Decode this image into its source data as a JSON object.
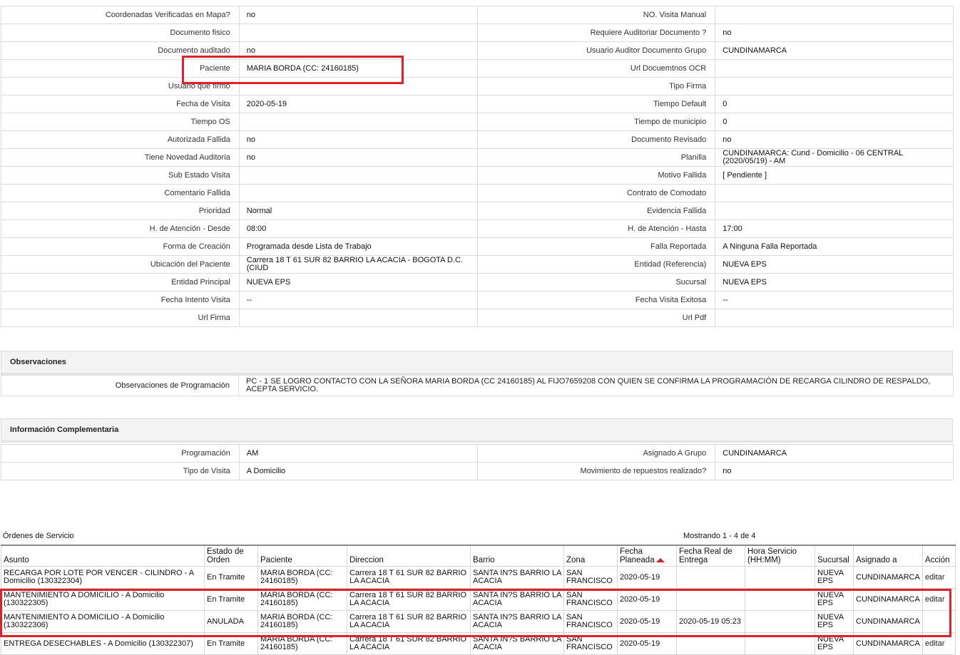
{
  "detail_rows": [
    {
      "l1": "Coordenadas Verificadas en Mapa?",
      "v1": "no",
      "l2": "NO. Visita Manual",
      "v2": ""
    },
    {
      "l1": "Documento fisico",
      "v1": "",
      "l2": "Requiere Auditoriar Documento ?",
      "v2": "no"
    },
    {
      "l1": "Documento auditado",
      "v1": "no",
      "l2": "Usuario Auditor Documento Grupo",
      "v2": "CUNDINAMARCA"
    },
    {
      "l1": "Paciente",
      "v1": "MARIA BORDA (CC: 24160185)",
      "l2": "Url Docuemtnos OCR",
      "v2": ""
    },
    {
      "l1": "Usuario que firmo",
      "v1": "",
      "l2": "Tipo Firma",
      "v2": ""
    },
    {
      "l1": "Fecha de Visita",
      "v1": "2020-05-19",
      "l2": "Tiempo Default",
      "v2": "0"
    },
    {
      "l1": "Tiempo OS",
      "v1": "",
      "l2": "Tiempo de municipio",
      "v2": "0"
    },
    {
      "l1": "Autorizada Fallida",
      "v1": "no",
      "l2": "Documento Revisado",
      "v2": "no"
    },
    {
      "l1": "Tiene Novedad Auditoria",
      "v1": "no",
      "l2": "Planilla",
      "v2": "CUNDINAMARCA: Cund - Domicilio - 06 CENTRAL (2020/05/19) - AM"
    },
    {
      "l1": "Sub Estado Visita",
      "v1": "",
      "l2": "Motivo Fallida",
      "v2": "[ Pendiente ]"
    },
    {
      "l1": "Comentario Fallida",
      "v1": "",
      "l2": "Contrato de Comodato",
      "v2": ""
    },
    {
      "l1": "Prioridad",
      "v1": "Normal",
      "l2": "Evidencia Fallida",
      "v2": ""
    },
    {
      "l1": "H. de Atención - Desde",
      "v1": "08:00",
      "l2": "H. de Atención - Hasta",
      "v2": "17:00"
    },
    {
      "l1": "Forma de Creación",
      "v1": "Programada desde Lista de Trabajo",
      "l2": "Falla Reportada",
      "v2": "A Ninguna Falla Reportada"
    },
    {
      "l1": "Ubicación del Paciente",
      "v1": "Carrera 18 T 61 SUR 82 BARRIO LA ACACIA - BOGOTA D.C. (CIUD",
      "l2": "Entidad (Referencia)",
      "v2": "NUEVA EPS"
    },
    {
      "l1": "Entidad Principal",
      "v1": "NUEVA EPS",
      "l2": "Sucursal",
      "v2": "NUEVA EPS"
    },
    {
      "l1": "Fecha Intento Visita",
      "v1": "--",
      "l2": "Fecha Visita Exitosa",
      "v2": "--"
    },
    {
      "l1": "Url Firma",
      "v1": "",
      "l2": "Url Pdf",
      "v2": ""
    }
  ],
  "observaciones": {
    "title": "Observaciones",
    "label": "Observaciones de Programación",
    "value": "PC - 1 SE LOGRO CONTACTO CON LA SEÑORA MARIA BORDA (CC 24160185) AL FIJO7659208 CON QUIEN SE CONFIRMA LA PROGRAMACIÓN DE RECARGA CILINDRO DE RESPALDO, ACEPTA SERVICIO."
  },
  "complementaria": {
    "title": "Información Complementaria",
    "rows": [
      {
        "l1": "Programación",
        "v1": "AM",
        "l2": "Asignado A Grupo",
        "v2": "CUNDINAMARCA"
      },
      {
        "l1": "Tipo de Visita",
        "v1": "A Domicilio",
        "l2": "Movimiento de repuestos realizado?",
        "v2": "no"
      }
    ]
  },
  "orders": {
    "caption": "Órdenes de Servicio",
    "count": "Mostrando 1 - 4 de 4",
    "headers": [
      "Asunto",
      "Estado de Orden",
      "Paciente",
      "Direccion",
      "Barrio",
      "Zona",
      "Fecha Planeada",
      "Fecha Real de Entrega",
      "Hora Servicio (HH:MM)",
      "Sucursal",
      "Asignado a",
      "Acción"
    ],
    "rows": [
      [
        "RECARGA POR LOTE POR VENCER - CILINDRO - A Domicilio (130322304)",
        "En Tramite",
        "MARIA BORDA (CC: 24160185)",
        "Carrera 18 T 61 SUR 82 BARRIO LA ACACIA",
        "SANTA IN?S BARRIO LA ACACIA",
        "SAN FRANCISCO",
        "2020-05-19",
        "",
        "",
        "NUEVA EPS",
        "CUNDINAMARCA",
        "editar"
      ],
      [
        "MANTENIMIENTO A DOMICILIO - A Domicilio (130322305)",
        "En Tramite",
        "MARIA BORDA (CC: 24160185)",
        "Carrera 18 T 61 SUR 82 BARRIO LA ACACIA",
        "SANTA IN?S BARRIO LA ACACIA",
        "SAN FRANCISCO",
        "2020-05-19",
        "",
        "",
        "NUEVA EPS",
        "CUNDINAMARCA",
        "editar"
      ],
      [
        "MANTENIMIENTO A DOMICILIO - A Domicilio (130322306)",
        "ANULADA",
        "MARIA BORDA (CC: 24160185)",
        "Carrera 18 T 61 SUR 82 BARRIO LA ACACIA",
        "SANTA IN?S BARRIO LA ACACIA",
        "SAN FRANCISCO",
        "2020-05-19",
        "2020-05-19 05:23",
        "",
        "NUEVA EPS",
        "CUNDINAMARCA",
        ""
      ],
      [
        "ENTREGA DESECHABLES - A Domicilio (130322307)",
        "En Tramite",
        "MARIA BORDA (CC: 24160185)",
        "Carrera 18 T 61 SUR 82 BARRIO LA ACACIA",
        "SANTA IN?S BARRIO LA ACACIA",
        "SAN FRANCISCO",
        "2020-05-19",
        "",
        "",
        "NUEVA EPS",
        "CUNDINAMARCA",
        "editar"
      ]
    ]
  },
  "colors": {
    "highlight": "#e0202a",
    "border": "#dcdcdc",
    "section_bg": "#f3f3f3"
  }
}
